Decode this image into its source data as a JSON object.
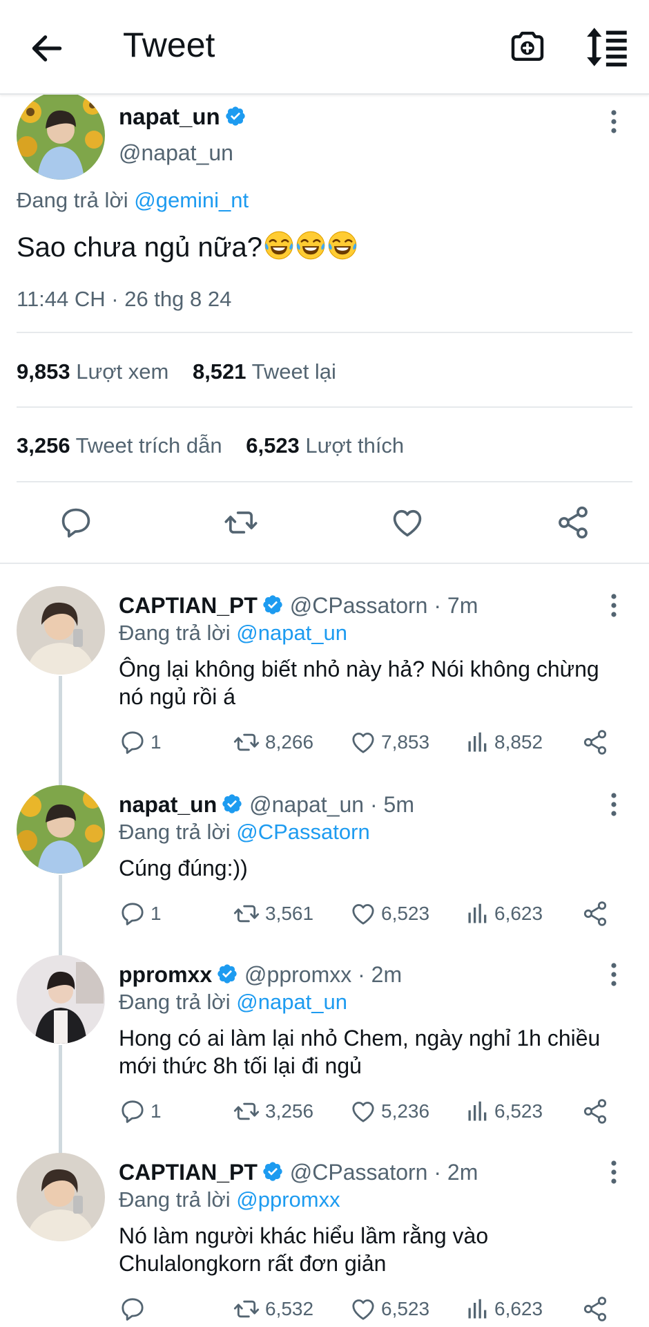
{
  "header": {
    "title": "Tweet",
    "back_icon": "arrow-left-icon",
    "camera_icon": "camera-plus-icon",
    "sort_icon": "sort-icon"
  },
  "main_tweet": {
    "name": "napat_un",
    "handle": "@napat_un",
    "replying_to_label": "Đang trả lời",
    "replying_to_handle": "@gemini_nt",
    "text": "Sao chưa ngủ nữa?",
    "emoji": "😂😂😂",
    "timestamp": "11:44 CH · 26 thg 8 24",
    "views_count": "9,853",
    "views_label": "Lượt xem",
    "retweets_count": "8,521",
    "retweets_label": "Tweet lại",
    "quotes_count": "3,256",
    "quotes_label": "Tweet trích dẫn",
    "likes_count": "6,523",
    "likes_label": "Lượt thích"
  },
  "replies": [
    {
      "name": "CAPTIAN_PT",
      "handle": "@CPassatorn",
      "time": "· 7m",
      "replying_to_label": "Đang trả lời",
      "replying_to_handle": "@napat_un",
      "text": "Ông lại không biết nhỏ này hả? Nói không chừng nó ngủ rồi á",
      "replies": "1",
      "retweets": "8,266",
      "likes": "7,853",
      "views": "8,852"
    },
    {
      "name": "napat_un",
      "handle": "@napat_un",
      "time": "· 5m",
      "replying_to_label": "Đang trả lời",
      "replying_to_handle": "@CPassatorn",
      "text": "Cúng đúng:))",
      "replies": "1",
      "retweets": "3,561",
      "likes": "6,523",
      "views": "6,623"
    },
    {
      "name": "ppromxx",
      "handle": "@ppromxx",
      "time": "· 2m",
      "replying_to_label": "Đang trả lời",
      "replying_to_handle": "@napat_un",
      "text": "Hong có ai làm lại nhỏ Chem, ngày nghỉ 1h chiều mới thức 8h tối lại đi ngủ",
      "replies": "1",
      "retweets": "3,256",
      "likes": "5,236",
      "views": "6,523"
    },
    {
      "name": "CAPTIAN_PT",
      "handle": "@CPassatorn",
      "time": "· 2m",
      "replying_to_label": "Đang trả lời",
      "replying_to_handle": "@ppromxx",
      "text": "Nó làm người khác hiểu lầm rằng vào Chulalongkorn rất đơn giản",
      "replies": "",
      "retweets": "6,532",
      "likes": "6,523",
      "views": "6,623"
    }
  ],
  "colors": {
    "accent": "#1d9bf0",
    "muted_text": "#536471",
    "primary_text": "#0f1419",
    "divider": "#e6e9ec",
    "thread_line": "#cfd9de"
  }
}
